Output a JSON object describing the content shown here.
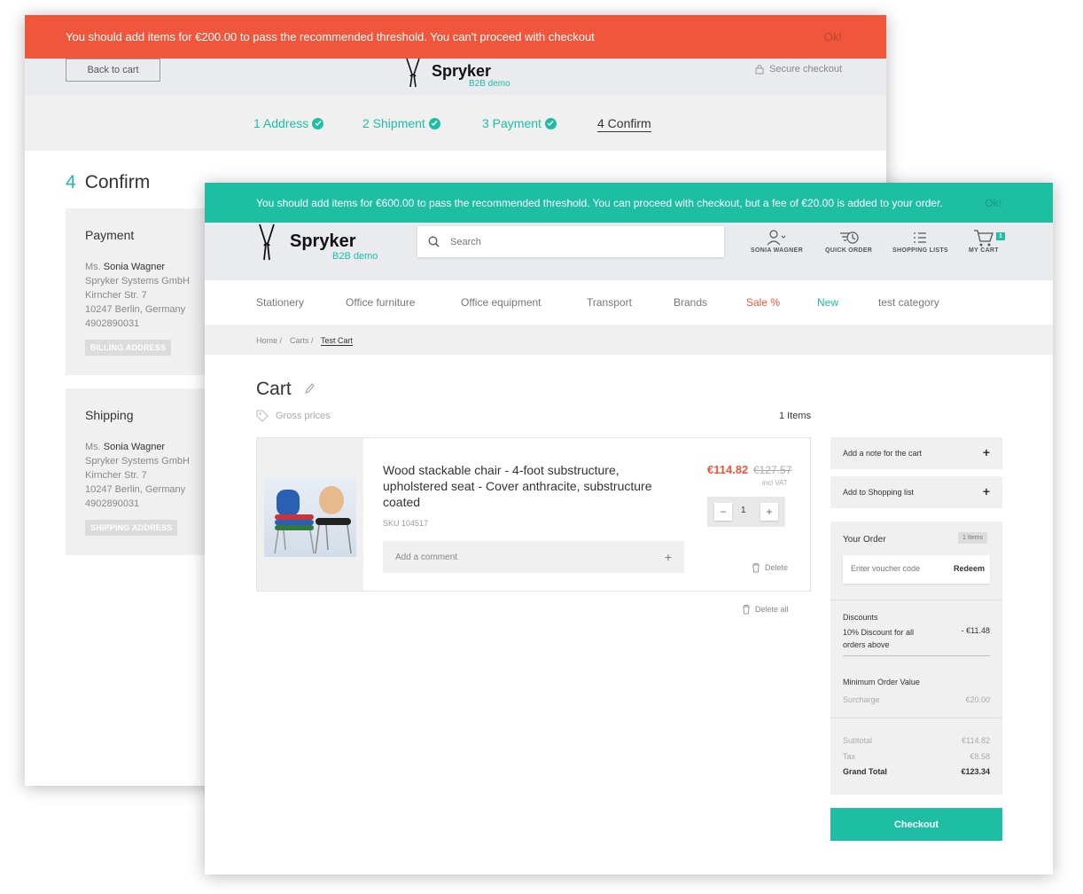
{
  "back": {
    "banner": {
      "message": "You should add items for €200.00 to pass the recommended threshold. You can't proceed with checkout",
      "ok": "Ok!"
    },
    "header": {
      "back_button": "Back to cart",
      "logo": "Spryker",
      "logo_sub": "B2B demo",
      "secure": "Secure checkout"
    },
    "steps": [
      {
        "label": "1 Address"
      },
      {
        "label": "2 Shipment"
      },
      {
        "label": "3 Payment"
      },
      {
        "label": "4 Confirm"
      }
    ],
    "confirm": {
      "number": "4",
      "title": "Confirm"
    },
    "payment": {
      "title": "Payment",
      "salutation": "Ms.",
      "name": "Sonia Wagner",
      "lines": [
        "Spryker Systems GmbH",
        "Kirncher Str. 7",
        "10247 Berlin, Germany",
        "4902890031"
      ],
      "tag": "BILLING ADDRESS"
    },
    "shipping": {
      "title": "Shipping",
      "salutation": "Ms.",
      "name": "Sonia Wagner",
      "lines": [
        "Spryker Systems GmbH",
        "Kirncher Str. 7",
        "10247 Berlin, Germany",
        "4902890031"
      ],
      "tag": "SHIPPING ADDRESS"
    }
  },
  "front": {
    "banner": {
      "message": "You should add items for €600.00 to pass the recommended threshold. You can proceed with checkout, but a fee of €20.00 is added to your order.",
      "ok": "Ok!"
    },
    "header": {
      "logo": "Spryker",
      "logo_sub": "B2B demo",
      "search_placeholder": "Search",
      "user": "SONIA WAGNER",
      "quick_order": "QUICK ORDER",
      "shopping_lists": "SHOPPING LISTS",
      "my_cart": "MY CART",
      "cart_count": "1"
    },
    "categories": [
      "Stationery",
      "Office furniture",
      "Office equipment",
      "Transport",
      "Brands",
      "Sale %",
      "New",
      "test category"
    ],
    "breadcrumb": {
      "home": "Home /",
      "carts": "Carts /",
      "current": "Test Cart"
    },
    "cart": {
      "title": "Cart",
      "gross": "Gross prices",
      "count": "1 Items"
    },
    "item": {
      "name": "Wood stackable chair - 4-foot substructure, upholstered seat - Cover anthracite, substructure coated",
      "sku": "SKU 104517",
      "comment": "Add a comment",
      "price": "€114.82",
      "old_price": "€127.57",
      "vat": "incl VAT",
      "qty": "1",
      "minus": "−",
      "plus": "+",
      "delete": "Delete"
    },
    "delete_all": "Delete all",
    "sidebar": {
      "note": "Add a note for the cart",
      "shopping_list": "Add to Shopping list",
      "order_title": "Your Order",
      "order_badge": "1 Items",
      "voucher_placeholder": "Enter voucher code",
      "redeem": "Redeem",
      "discounts_title": "Discounts",
      "discount_name": "10% Discount for all orders above",
      "discount_value": "- €11.48",
      "min_order_title": "Minimum Order Value",
      "surcharge_label": "Surcharge",
      "surcharge_value": "€20.00",
      "subtotal_label": "Subtotal",
      "subtotal_value": "€114.82",
      "tax_label": "Tax",
      "tax_value": "€8.58",
      "grand_label": "Grand Total",
      "grand_value": "€123.34",
      "checkout": "Checkout"
    }
  },
  "colors": {
    "accent": "#1ebea5",
    "error": "#ef563c",
    "header_bg": "#e9ebee"
  }
}
